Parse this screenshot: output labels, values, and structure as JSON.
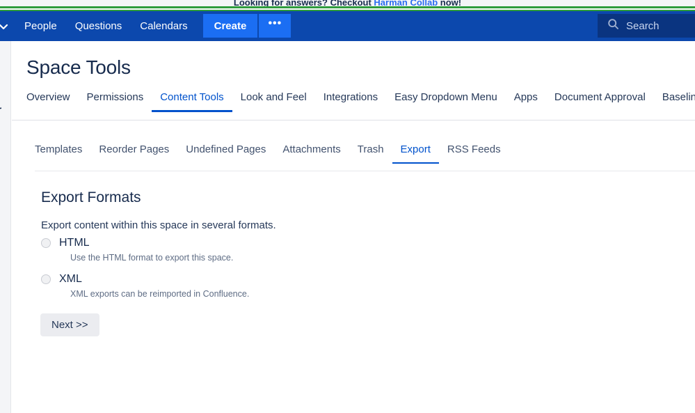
{
  "promo": {
    "prefix": "Looking for answers? Checkout ",
    "link": "Harman Collab",
    "suffix": " now!"
  },
  "topnav": {
    "chevron_icon": "chevron-down-icon",
    "items": [
      {
        "label": "People"
      },
      {
        "label": "Questions"
      },
      {
        "label": "Calendars"
      }
    ],
    "create_label": "Create",
    "more_label": "•••",
    "search": {
      "icon": "search-icon",
      "placeholder": "Search",
      "value": "Search"
    }
  },
  "sidebar": {
    "truncated_label": "r",
    "resize_handle": "sidebar-resize-handle"
  },
  "header": {
    "title": "Space Tools",
    "tabs": [
      {
        "label": "Overview",
        "active": false
      },
      {
        "label": "Permissions",
        "active": false
      },
      {
        "label": "Content Tools",
        "active": true
      },
      {
        "label": "Look and Feel",
        "active": false
      },
      {
        "label": "Integrations",
        "active": false
      },
      {
        "label": "Easy Dropdown Menu",
        "active": false
      },
      {
        "label": "Apps",
        "active": false
      },
      {
        "label": "Document Approval",
        "active": false
      },
      {
        "label": "Baseline",
        "active": false
      }
    ]
  },
  "content": {
    "subtabs": [
      {
        "label": "Templates",
        "active": false
      },
      {
        "label": "Reorder Pages",
        "active": false
      },
      {
        "label": "Undefined Pages",
        "active": false
      },
      {
        "label": "Attachments",
        "active": false
      },
      {
        "label": "Trash",
        "active": false
      },
      {
        "label": "Export",
        "active": true
      },
      {
        "label": "RSS Feeds",
        "active": false
      }
    ],
    "section_title": "Export Formats",
    "section_desc": "Export content within this space in several formats.",
    "options": [
      {
        "label": "HTML",
        "help": "Use the HTML format to export this space.",
        "selected": false
      },
      {
        "label": "XML",
        "help": "XML exports can be reimported in Confluence.",
        "selected": false
      }
    ],
    "next_label": "Next >>"
  },
  "colors": {
    "nav_blue": "#0c48ad",
    "create_blue": "#1b6ef3",
    "search_navy": "#0a3480",
    "accent": "#0052cc",
    "banner_green": "#2e9c3c",
    "text_dark": "#172b4d",
    "text_muted": "#5e6c84",
    "button_grey": "#ebecf0"
  }
}
